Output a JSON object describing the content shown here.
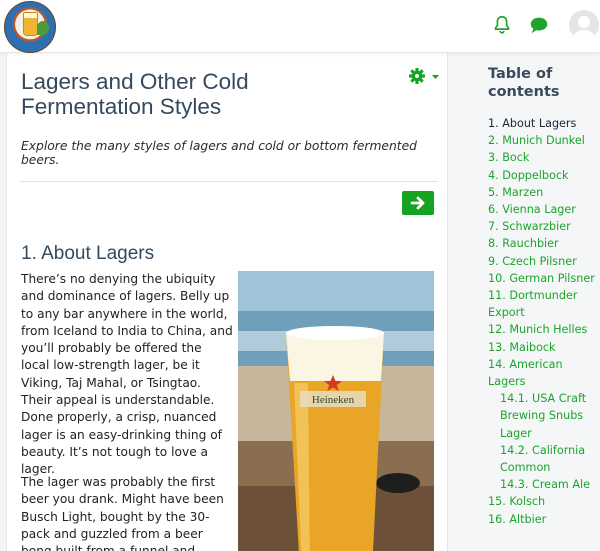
{
  "header": {
    "logo_alt": "Beer Styles logo",
    "icons": [
      "bell-icon",
      "chat-icon",
      "avatar"
    ]
  },
  "colors": {
    "accent": "#16a31f",
    "toc_link": "#1ca52a",
    "heading": "#34495e"
  },
  "main": {
    "title": "Lagers and Other Cold Fermentation Styles",
    "intro": "Explore the many styles of lagers and cold or bottom fermented beers.",
    "section_heading": "1. About Lagers",
    "paragraphs": [
      "There’s no denying the ubiquity and dominance of lagers. Belly up to any bar anywhere in the world, from Iceland to India to China, and you’ll probably be offered the local low-strength lager, be it Viking, Taj Mahal, or Tsingtao. Their appeal is understandable. Done properly, a crisp, nuanced lager is an easy-drinking thing of beauty. It’s not tough to love a lager.",
      "The lager was probably the first beer you drank. Might have been Busch Light, bought by the 30-pack and guzzled from a beer bong built from a funnel and plastic tubing. A"
    ],
    "photo_brand": "Heineken"
  },
  "toc": {
    "title": "Table of contents",
    "items": [
      {
        "label": "1. About Lagers",
        "active": true
      },
      {
        "label": "2. Munich Dunkel"
      },
      {
        "label": "3. Bock"
      },
      {
        "label": "4. Doppelbock"
      },
      {
        "label": "5. Marzen"
      },
      {
        "label": "6. Vienna Lager"
      },
      {
        "label": "7. Schwarzbier"
      },
      {
        "label": "8. Rauchbier"
      },
      {
        "label": "9. Czech Pilsner"
      },
      {
        "label": "10. German Pilsner"
      },
      {
        "label": "11. Dortmunder Export"
      },
      {
        "label": "12. Munich Helles"
      },
      {
        "label": "13. Maibock"
      },
      {
        "label": "14. American Lagers"
      },
      {
        "label": "14.1. USA Craft Brewing Snubs Lager",
        "sub": true
      },
      {
        "label": "14.2. California Common",
        "sub": true
      },
      {
        "label": "14.3. Cream Ale",
        "sub": true
      },
      {
        "label": "15. Kolsch"
      },
      {
        "label": "16. Altbier"
      }
    ]
  }
}
